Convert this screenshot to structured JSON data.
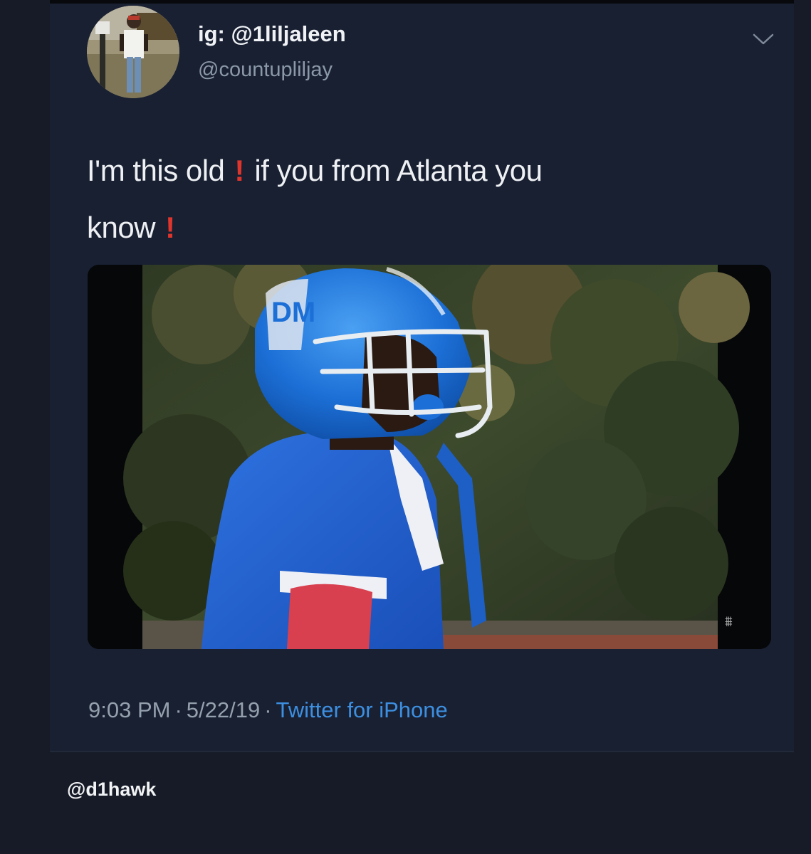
{
  "tweet": {
    "display_name": "ig: @1liljaleen",
    "handle": "@countupliljay",
    "text_line1_part1": "I'm this old",
    "text_line1_part2": "if you from Atlanta you",
    "text_line2": "know",
    "emphasis_mark": "!",
    "emphasis_color": "#e0352c",
    "time": "9:03 PM",
    "date": "5/22/19",
    "separator": "·",
    "source": "Twitter for iPhone",
    "source_color": "#3d8fe0",
    "media_icon": "football-player-photo",
    "menu_icon": "chevron-down-icon"
  },
  "credit": "@d1hawk"
}
